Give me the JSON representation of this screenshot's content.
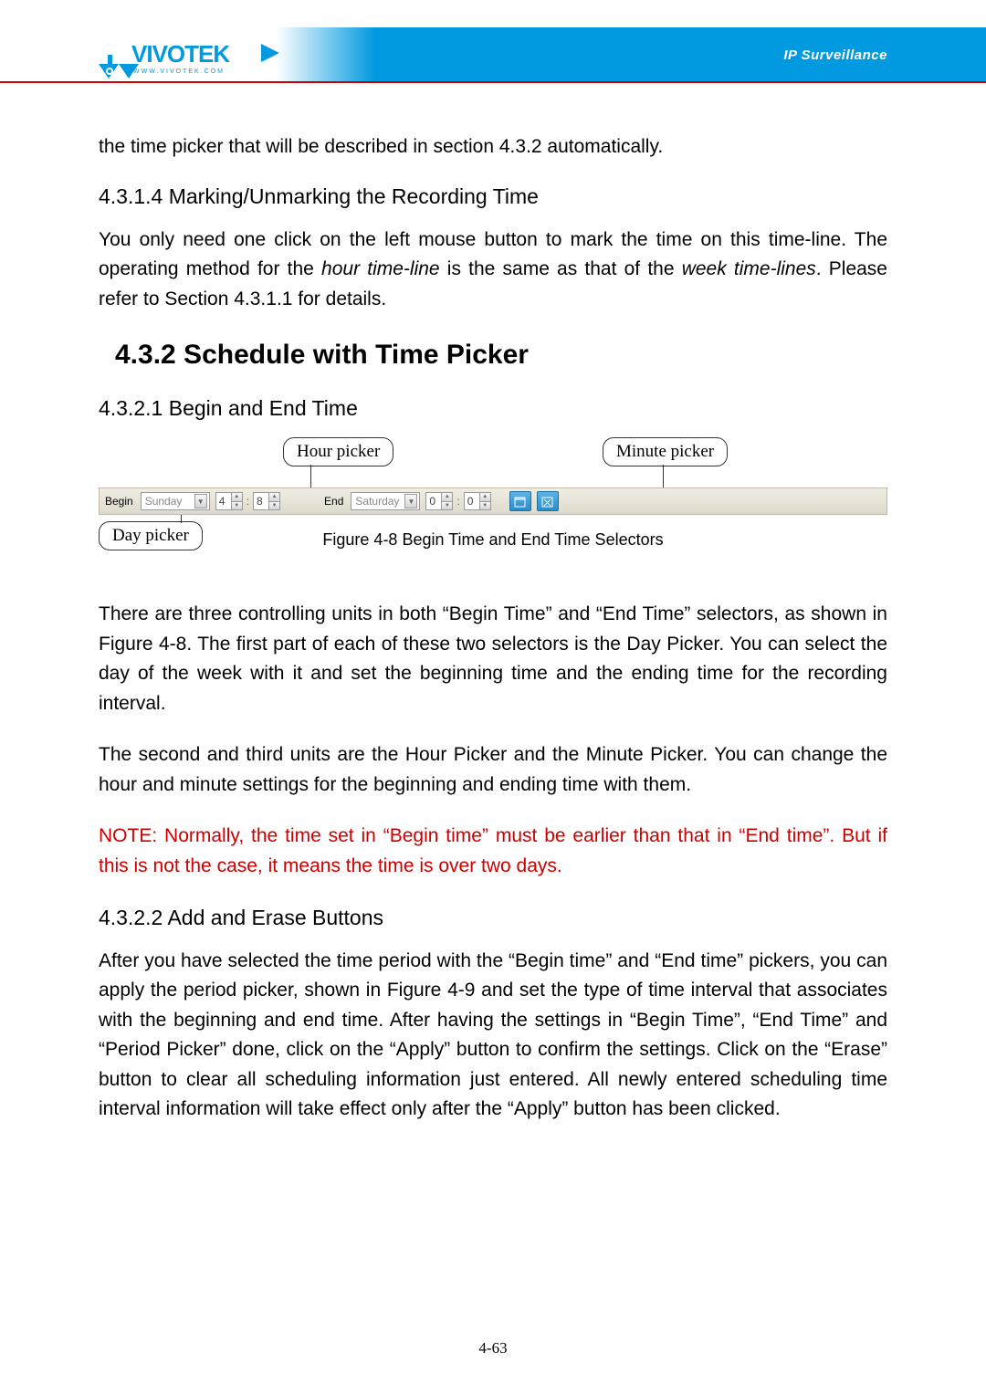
{
  "header": {
    "brand_text": "VIVOTEK",
    "brand_sub": "www.vivotek.com",
    "right_text": "IP Surveillance"
  },
  "intro": {
    "p1": "the time picker that will be described in section 4.3.2 automatically."
  },
  "s4314": {
    "heading": "4.3.1.4 Marking/Unmarking the Recording Time",
    "p1_a": "You only need one click on the left mouse button to mark the time on this time-line. The operating method for the ",
    "p1_b": "hour time-line",
    "p1_c": " is the same as that of the ",
    "p1_d": "week time-lines",
    "p1_e": ". Please refer to Section 4.3.1.1 for details."
  },
  "s432": {
    "heading": "4.3.2  Schedule with Time Picker"
  },
  "s4321": {
    "heading": "4.3.2.1 Begin and End Time",
    "callouts": {
      "hour": "Hour picker",
      "minute": "Minute picker",
      "day": "Day picker"
    },
    "toolbar": {
      "begin_label": "Begin",
      "begin_day": "Sunday",
      "begin_hour": "4",
      "begin_min": "8",
      "end_label": "End",
      "end_day": "Saturday",
      "end_hour": "0",
      "end_min": "0"
    },
    "caption": "Figure 4-8 Begin Time and End Time Selectors",
    "p1": "There are three controlling units in both “Begin Time” and “End Time” selectors, as shown in Figure 4-8. The first part of each of these two selectors is the Day Picker. You can select the day of the week with it and set the beginning time and the ending time for the recording interval.",
    "p2": "The second and third units are the Hour Picker and the Minute Picker. You can change the hour and minute settings for the beginning and ending time with them.",
    "note": "NOTE: Normally, the time set in “Begin time” must be earlier than that in “End time”. But if this is not the case, it means the time is over two days."
  },
  "s4322": {
    "heading": "4.3.2.2 Add and Erase Buttons",
    "p1": "After you have selected the time period with the “Begin time” and “End time” pickers, you can apply the period picker, shown in Figure 4-9 and set the type of time interval that associates with the beginning and end time. After having the settings in “Begin Time”, “End Time” and “Period Picker” done, click on the “Apply” button to confirm the settings. Click on the “Erase” button to clear all scheduling information just entered. All newly entered scheduling time interval information will take effect only after the “Apply” button has been clicked."
  },
  "footer": {
    "page": "4-63"
  }
}
